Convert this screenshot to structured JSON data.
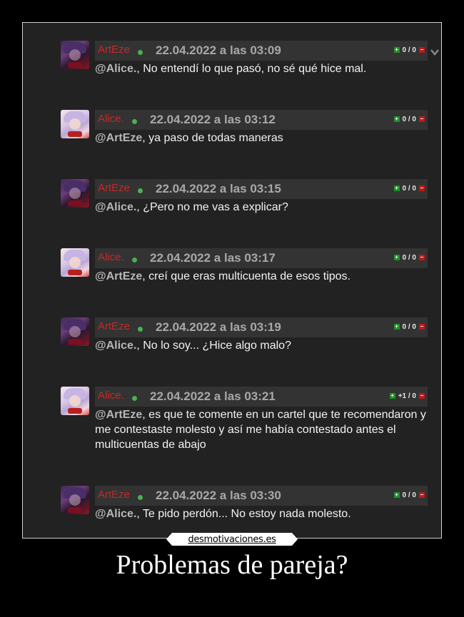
{
  "site_logo": "desmotivaciones.es",
  "caption": "Problemas de pareja?",
  "comments": [
    {
      "user": "ArtEze",
      "avatar": "artEze",
      "date": "22.04.2022 a las 03:09",
      "votes": "0 / 0",
      "mention": "@Alice.",
      "text": ", No entendí lo que pasó, no sé qué hice mal."
    },
    {
      "user": "Alice.",
      "avatar": "alice",
      "date": "22.04.2022 a las 03:12",
      "votes": "0 / 0",
      "mention": "@ArtEze",
      "text": ", ya paso de todas maneras"
    },
    {
      "user": "ArtEze",
      "avatar": "artEze",
      "date": "22.04.2022 a las 03:15",
      "votes": "0 / 0",
      "mention": "@Alice.",
      "text": ", ¿Pero no me vas a explicar?"
    },
    {
      "user": "Alice.",
      "avatar": "alice",
      "date": "22.04.2022 a las 03:17",
      "votes": "0 / 0",
      "mention": "@ArtEze",
      "text": ", creí que eras multicuenta de esos tipos."
    },
    {
      "user": "ArtEze",
      "avatar": "artEze",
      "date": "22.04.2022 a las 03:19",
      "votes": "0 / 0",
      "mention": "@Alice.",
      "text": ", No lo soy... ¿Hice algo malo?"
    },
    {
      "user": "Alice.",
      "avatar": "alice",
      "date": "22.04.2022 a las 03:21",
      "votes": "+1 / 0",
      "mention": "@ArtEze",
      "text": ", es que te comente en un cartel que te recomendaron y me contestaste molesto y así me había contestado antes el multicuentas de abajo"
    },
    {
      "user": "ArtEze",
      "avatar": "artEze",
      "date": "22.04.2022 a las 03:30",
      "votes": "0 / 0",
      "mention": "@Alice.",
      "text": ", Te pido perdón... No estoy nada molesto."
    }
  ],
  "colors": {
    "username": "#c22a2a",
    "online_dot": "#4caf50",
    "vote_plus": "#1f8f2a",
    "vote_minus": "#c01818"
  }
}
